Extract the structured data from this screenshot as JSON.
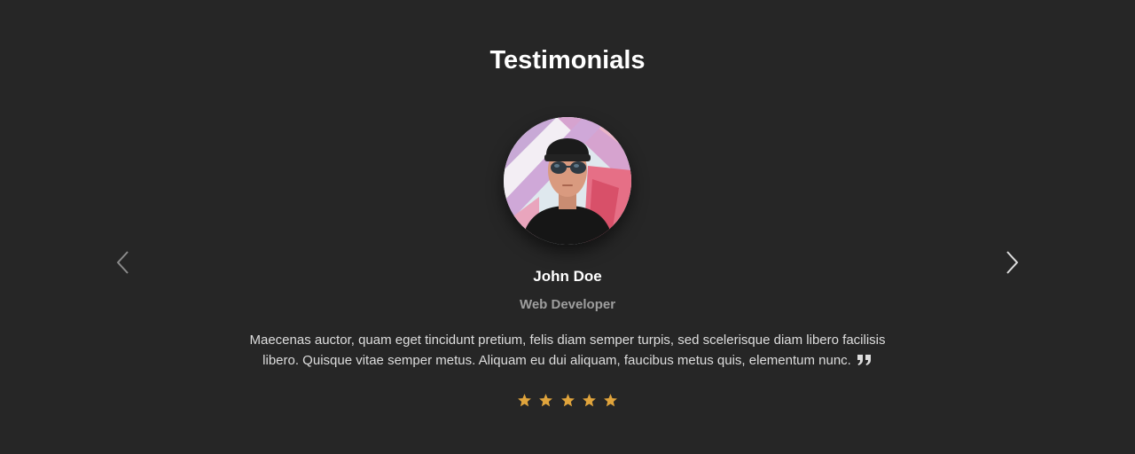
{
  "section": {
    "title": "Testimonials"
  },
  "testimonial": {
    "name": "John Doe",
    "role": "Web Developer",
    "quote": "Maecenas auctor, quam eget tincidunt pretium, felis diam semper turpis, sed scelerisque diam libero facilisis libero. Quisque vitae semper metus. Aliquam eu dui aliquam, faucibus metus quis, elementum nunc.",
    "quote_icon": "quote-right-icon",
    "rating": 5,
    "rating_max": 5
  },
  "navigation": {
    "prev_icon": "chevron-left-icon",
    "next_icon": "chevron-right-icon"
  },
  "colors": {
    "background": "#262626",
    "star": "#e0a43c",
    "muted_text": "#9e9e9e"
  }
}
